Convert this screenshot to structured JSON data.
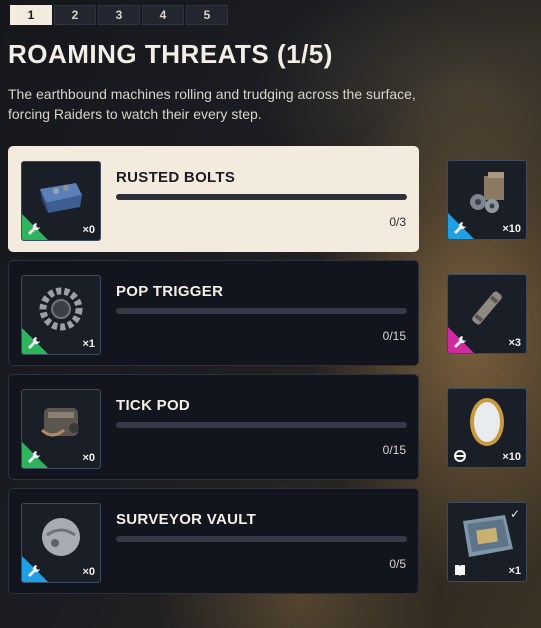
{
  "tabs": [
    "1",
    "2",
    "3",
    "4",
    "5"
  ],
  "active_tab": "1",
  "title": "ROAMING THREATS (1/5)",
  "description": "The earthbound machines rolling and trudging across the surface, forcing Raiders to watch their every step.",
  "objectives": [
    {
      "name": "RUSTED BOLTS",
      "progress": "0/3",
      "completion": 0,
      "item": {
        "icon": "bolts-box-icon",
        "quantity": "×0",
        "rarity_color": "#2eb45c"
      },
      "reward": {
        "icon": "parts-crate-icon",
        "quantity": "×10",
        "rarity_color": "#1ea0e6"
      }
    },
    {
      "name": "POP TRIGGER",
      "progress": "0/15",
      "completion": 0,
      "item": {
        "icon": "gear-ring-icon",
        "quantity": "×1",
        "rarity_color": "#2eb45c"
      },
      "reward": {
        "icon": "tube-component-icon",
        "quantity": "×3",
        "rarity_color": "#d02aa0"
      }
    },
    {
      "name": "TICK POD",
      "progress": "0/15",
      "completion": 0,
      "item": {
        "icon": "tick-pod-icon",
        "quantity": "×0",
        "rarity_color": "#2eb45c"
      },
      "reward": {
        "icon": "mirror-icon",
        "quantity": "×10"
      }
    },
    {
      "name": "SURVEYOR VAULT",
      "progress": "0/5",
      "completion": 0,
      "item": {
        "icon": "vault-sphere-icon",
        "quantity": "×0",
        "rarity_color": "#1ea0e6"
      },
      "reward": {
        "icon": "blueprint-case-icon",
        "quantity": "×1"
      }
    }
  ],
  "colors": {
    "active_card": "#f3ebdd",
    "card": "#12151d",
    "green": "#2eb45c",
    "blue": "#1ea0e6",
    "magenta": "#d02aa0"
  }
}
